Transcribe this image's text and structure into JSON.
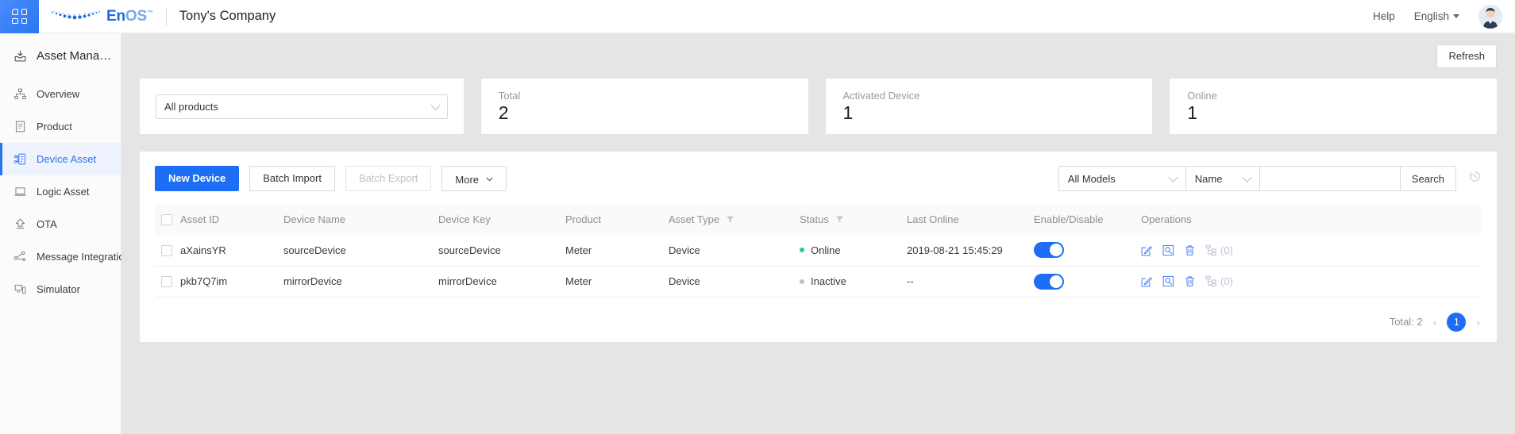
{
  "header": {
    "app_launcher_icon": "grid-icon",
    "brand_en": "En",
    "brand_os": "OS",
    "brand_tm": "™",
    "company": "Tony's Company",
    "help": "Help",
    "language": "English",
    "avatar_icon": "user-avatar"
  },
  "sidebar": {
    "title": "Asset Manag…",
    "title_icon": "asset-inbox-icon",
    "items": [
      {
        "label": "Overview",
        "icon": "sitemap-icon",
        "active": false
      },
      {
        "label": "Product",
        "icon": "document-icon",
        "active": false
      },
      {
        "label": "Device Asset",
        "icon": "device-node-icon",
        "active": true
      },
      {
        "label": "Logic Asset",
        "icon": "laptop-icon",
        "active": false
      },
      {
        "label": "OTA",
        "icon": "upload-arrow-icon",
        "active": false
      },
      {
        "label": "Message Integration",
        "icon": "share-nodes-icon",
        "active": false
      },
      {
        "label": "Simulator",
        "icon": "simulator-icon",
        "active": false
      }
    ]
  },
  "main": {
    "refresh_label": "Refresh",
    "product_filter": {
      "value": "All products",
      "icon": "chevron-down-icon"
    },
    "stats": [
      {
        "label": "Total",
        "value": "2"
      },
      {
        "label": "Activated Device",
        "value": "1"
      },
      {
        "label": "Online",
        "value": "1"
      }
    ],
    "toolbar": {
      "new_device": "New Device",
      "batch_import": "Batch Import",
      "batch_export": "Batch Export",
      "more": "More",
      "model_filter": "All Models",
      "field_filter": "Name",
      "search_value": "",
      "search_placeholder": "",
      "search_button": "Search",
      "history_icon": "history-clock-icon"
    },
    "table": {
      "columns": [
        {
          "label": "Asset ID",
          "filter": false
        },
        {
          "label": "Device Name",
          "filter": false
        },
        {
          "label": "Device Key",
          "filter": false
        },
        {
          "label": "Product",
          "filter": false
        },
        {
          "label": "Asset Type",
          "filter": true
        },
        {
          "label": "Status",
          "filter": true
        },
        {
          "label": "Last Online",
          "filter": false
        },
        {
          "label": "Enable/Disable",
          "filter": false
        },
        {
          "label": "Operations",
          "filter": false
        }
      ],
      "rows": [
        {
          "asset_id": "aXainsYR",
          "device_name": "sourceDevice",
          "device_key": "sourceDevice",
          "product": "Meter",
          "asset_type": "Device",
          "status": "Online",
          "status_color": "#21c8a8",
          "last_online": "2019-08-21 15:45:29",
          "enabled": true,
          "sub_count": "(0)"
        },
        {
          "asset_id": "pkb7Q7im",
          "device_name": "mirrorDevice",
          "device_key": "mirrorDevice",
          "product": "Meter",
          "asset_type": "Device",
          "status": "Inactive",
          "status_color": "#bfbfbf",
          "last_online": "--",
          "enabled": true,
          "sub_count": "(0)"
        }
      ],
      "ops_icons": [
        "edit-icon",
        "view-icon",
        "delete-icon",
        "sub-device-tree-icon"
      ]
    },
    "pagination": {
      "total_label": "Total: 2",
      "prev": "‹",
      "page": "1",
      "next": "›"
    }
  },
  "colors": {
    "primary": "#1d6ef5",
    "online": "#21c8a8",
    "inactive": "#bfbfbf",
    "page_bg": "#e5e5e5"
  }
}
